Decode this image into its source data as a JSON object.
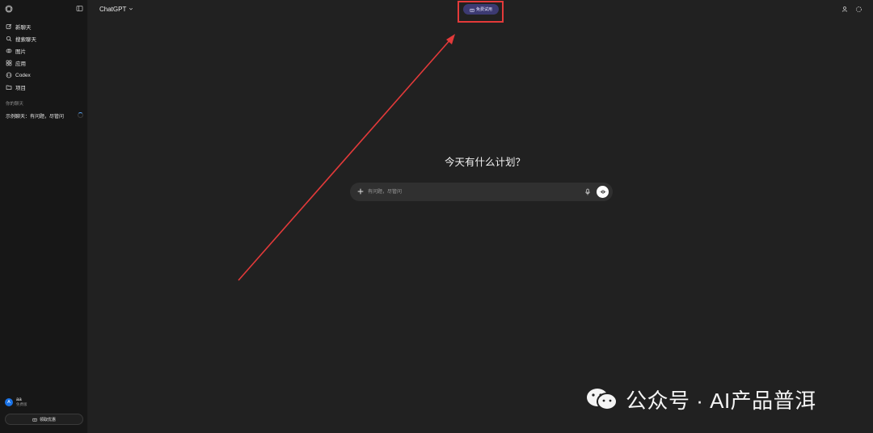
{
  "sidebar": {
    "items": [
      {
        "label": "新聊天",
        "icon": "new-chat-icon"
      },
      {
        "label": "搜索聊天",
        "icon": "search-icon"
      },
      {
        "label": "图片",
        "icon": "image-icon"
      },
      {
        "label": "应用",
        "icon": "apps-grid-icon"
      },
      {
        "label": "Codex",
        "icon": "codex-icon"
      },
      {
        "label": "项目",
        "icon": "folder-icon"
      }
    ],
    "section_title": "你的聊天",
    "chats": [
      {
        "label": "示例聊天：有问题，尽管问"
      }
    ],
    "user": {
      "avatar_letter": "A",
      "name": "aa",
      "plan": "免费版"
    },
    "upgrade_label": "领取优惠"
  },
  "header": {
    "model_name": "ChatGPT",
    "free_trial_label": "免费试用"
  },
  "main": {
    "greeting": "今天有什么计划？",
    "composer": {
      "placeholder": "有问题，尽管问"
    }
  },
  "watermark": {
    "text": "公众号 · AI产品普洱"
  },
  "colors": {
    "background": "#212121",
    "sidebar": "#171717",
    "composer": "#303030",
    "trial_pill": "#3c3a72",
    "annotation_red": "#e33a3a",
    "avatar_blue": "#1a73e8"
  }
}
